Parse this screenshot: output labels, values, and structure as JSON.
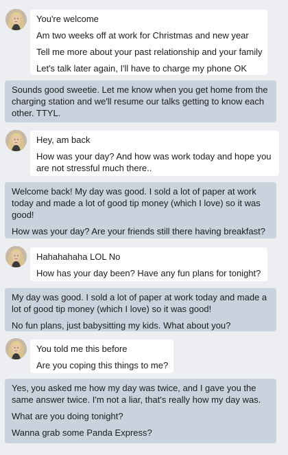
{
  "conversation": {
    "them_1": [
      "You're welcome",
      "Am two weeks off at work for Christmas and new year",
      "Tell me more about your past relationship and your family",
      "Let's talk later again, I'll have to charge my phone OK"
    ],
    "me_1": [
      "Sounds good sweetie. Let me know when you get home from the charging station and we'll resume our talks getting to know each other. TTYL."
    ],
    "them_2": [
      "Hey, am back",
      "How was your day? And how was work today and hope you are not stressful much there.."
    ],
    "me_2": [
      "Welcome back! My day was good. I sold a lot of paper at work today and made a lot of good tip money (which I love) so it was good!",
      "How was your day? Are your friends still there having breakfast?"
    ],
    "them_3": [
      "Hahahahaha LOL No",
      "How has your day been?  Have any fun plans for tonight?"
    ],
    "me_3": [
      "My day was good. I sold a lot of paper at work today and made a lot of good tip money (which I love) so it was good!",
      "No fun plans, just babysitting my kids. What about you?"
    ],
    "them_4": [
      "You told me this before",
      "Are you coping this things to me?"
    ],
    "me_4": [
      "Yes, you asked me how my day was twice, and I gave you the same answer twice. I'm not a liar, that's really how my day was.",
      "What are you doing tonight?",
      "Wanna grab some Panda Express?"
    ]
  },
  "colors": {
    "background": "#eceef1",
    "incoming_bubble": "#ffffff",
    "outgoing_bubble": "#c9d3dd",
    "text": "#1c1c1c"
  },
  "icons": {
    "avatar": "blonde-woman-profile-photo"
  }
}
